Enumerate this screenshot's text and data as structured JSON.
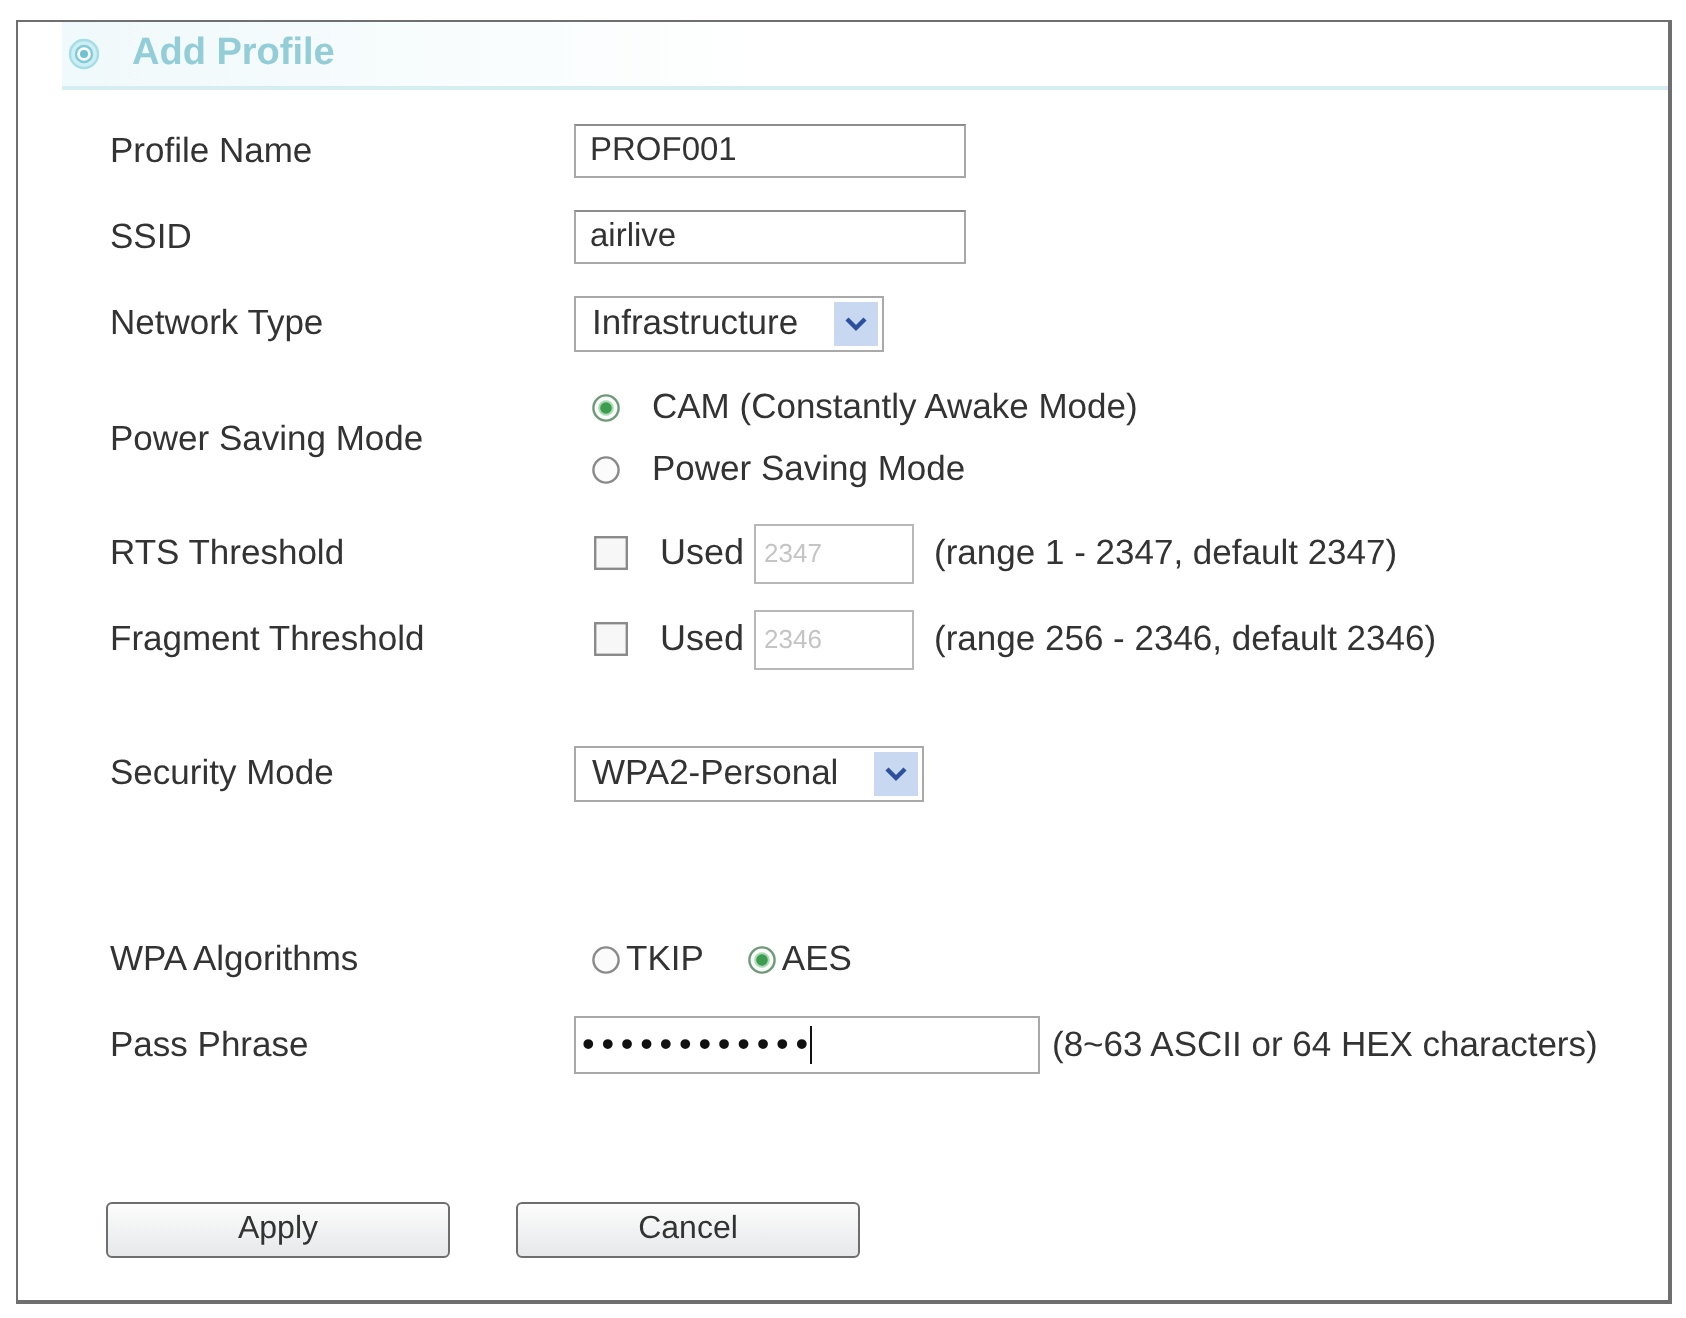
{
  "panel": {
    "title": "Add Profile"
  },
  "sections": [
    {
      "fields": [
        {
          "kind": "text",
          "label": "Profile Name",
          "value": "PROF001"
        },
        {
          "kind": "text",
          "label": "SSID",
          "value": "airlive"
        },
        {
          "kind": "select",
          "label": "Network Type",
          "value": "Infrastructure"
        },
        {
          "kind": "radio_stack",
          "label": "Power Saving Mode",
          "options": [
            {
              "label": "CAM (Constantly Awake Mode)",
              "selected": true
            },
            {
              "label": "Power Saving Mode",
              "selected": false
            }
          ]
        },
        {
          "kind": "threshold",
          "label": "RTS Threshold",
          "checked": false,
          "check_label": "Used",
          "value": "2347",
          "disabled": true,
          "hint": "(range 1 - 2347, default 2347)"
        },
        {
          "kind": "threshold",
          "label": "Fragment Threshold",
          "checked": false,
          "check_label": "Used",
          "value": "2346",
          "disabled": true,
          "hint": "(range 256 - 2346, default 2346)"
        }
      ]
    },
    {
      "fields": [
        {
          "kind": "select",
          "label": "Security Mode",
          "value": "WPA2-Personal"
        }
      ]
    },
    {
      "fields": [
        {
          "kind": "radio_inline",
          "label": "WPA Algorithms",
          "options": [
            {
              "label": "TKIP",
              "selected": false
            },
            {
              "label": "AES",
              "selected": true
            }
          ]
        },
        {
          "kind": "password",
          "label": "Pass Phrase",
          "value": "••••••••••••",
          "focused": true,
          "hint": "(8~63 ASCII or 64 HEX characters)"
        }
      ]
    }
  ],
  "buttons": [
    {
      "label": "Apply"
    },
    {
      "label": "Cancel"
    }
  ]
}
